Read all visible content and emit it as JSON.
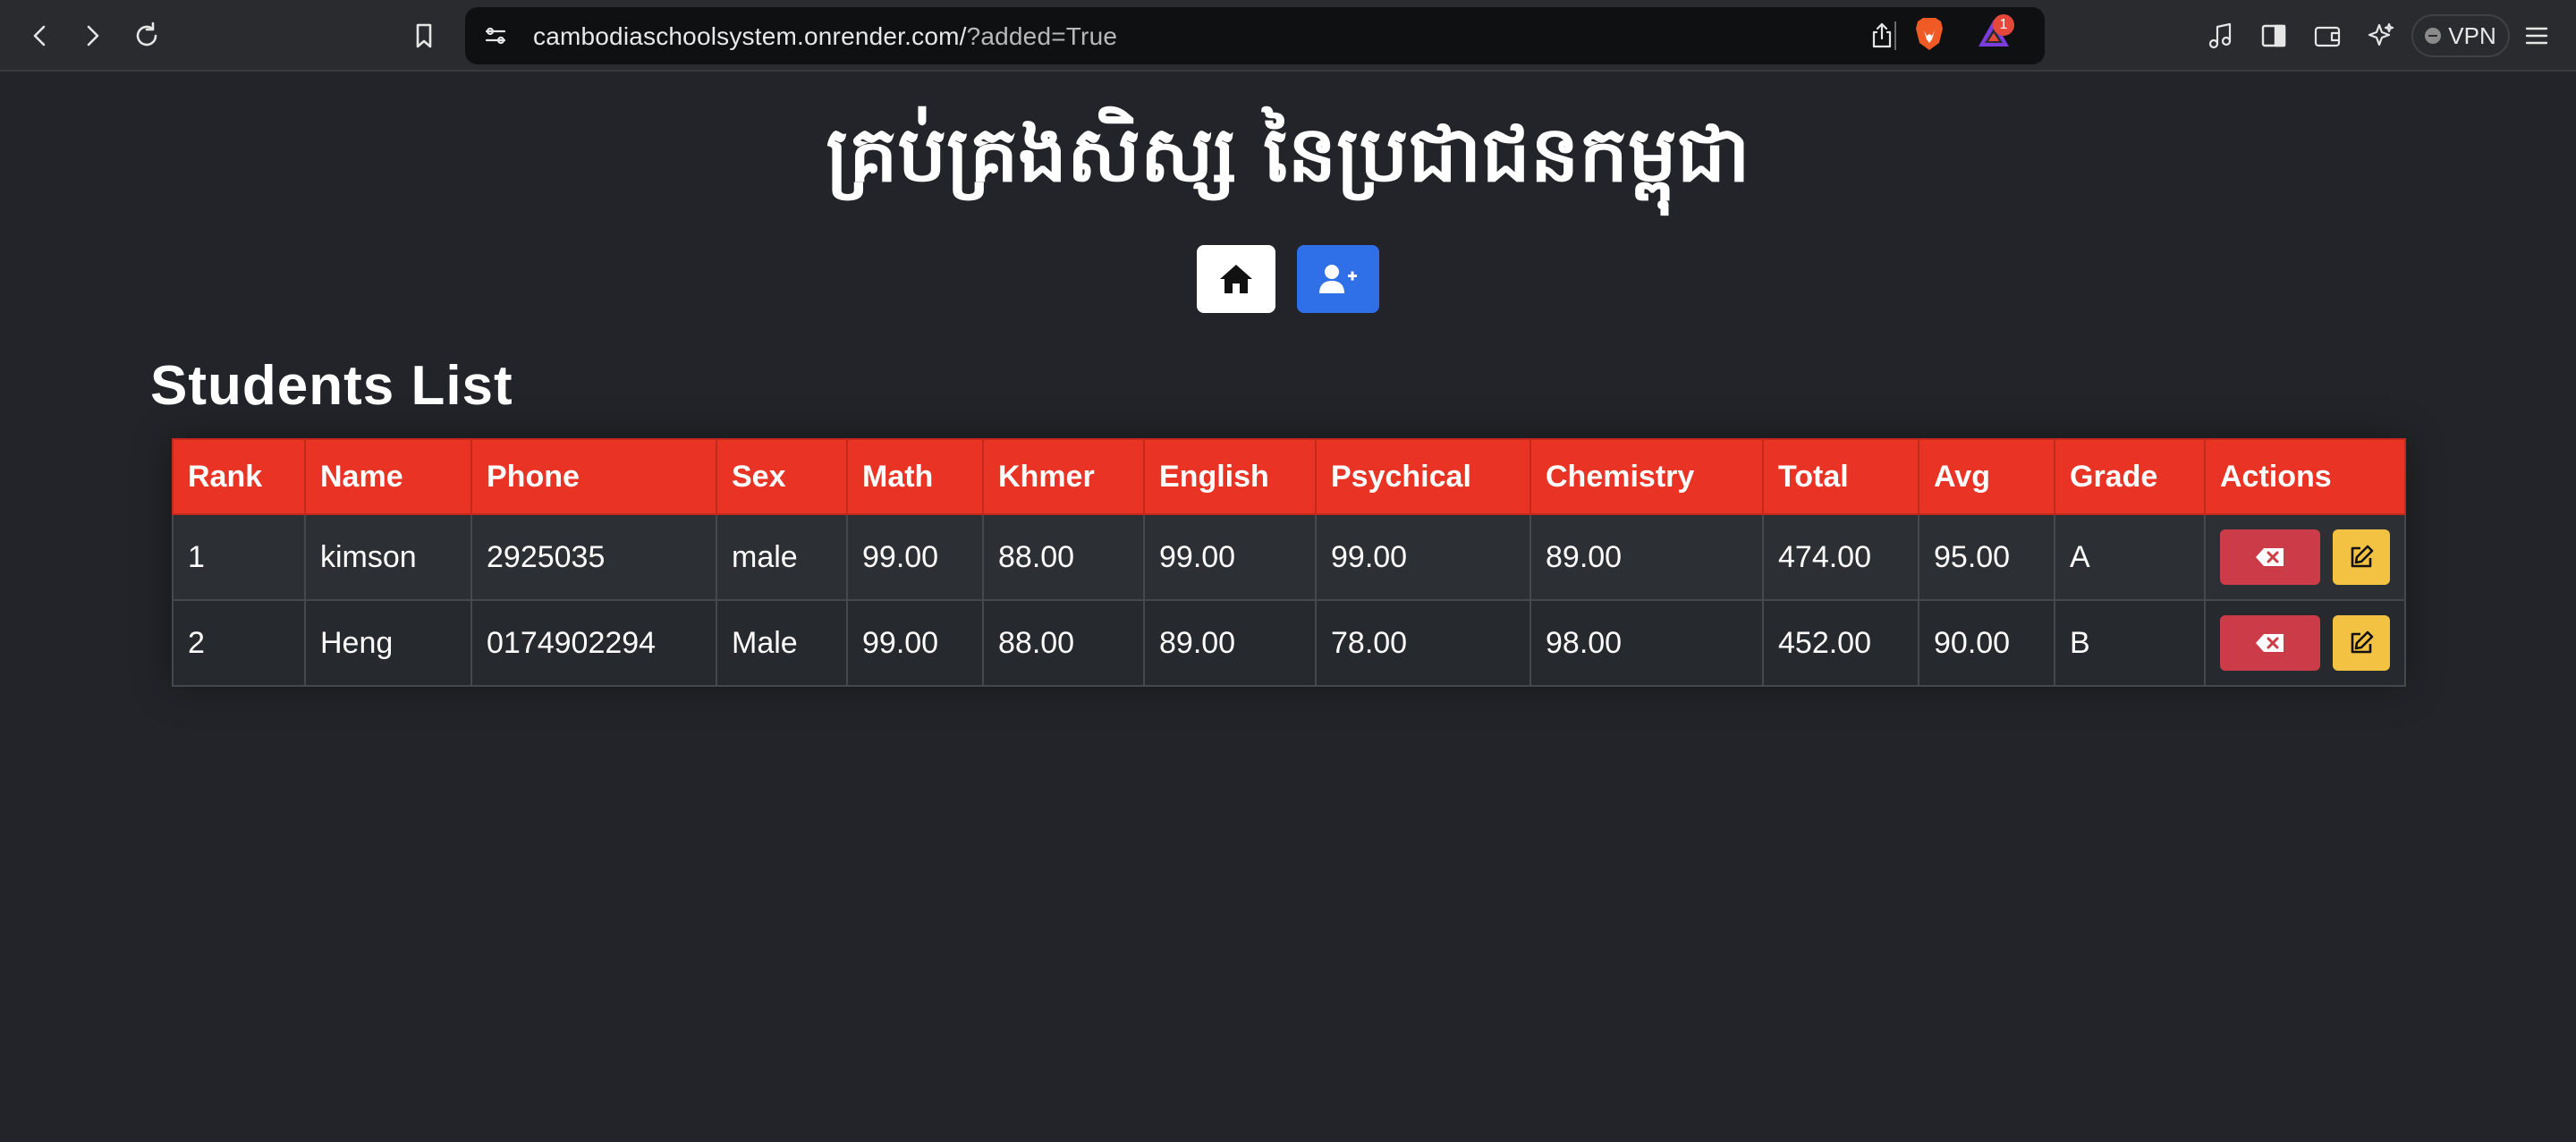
{
  "browser": {
    "url_main": "cambodiaschoolsystem.onrender.com/",
    "url_query": "?added=True",
    "notification_count": "1",
    "vpn_label": "VPN"
  },
  "page": {
    "title": "គ្រប់គ្រងសិស្ស នៃប្រជាជនកម្ពុជា",
    "section_title": "Students List"
  },
  "nav": {
    "home_icon": "home-icon",
    "add_icon": "add-user-icon",
    "add_button_color": "#2f6fe8"
  },
  "table": {
    "headers": [
      "Rank",
      "Name",
      "Phone",
      "Sex",
      "Math",
      "Khmer",
      "English",
      "Psychical",
      "Chemistry",
      "Total",
      "Avg",
      "Grade",
      "Actions"
    ],
    "rows": [
      {
        "rank": "1",
        "name": "kimson",
        "phone": "2925035",
        "sex": "male",
        "math": "99.00",
        "khmer": "88.00",
        "english": "99.00",
        "psychical": "99.00",
        "chemistry": "89.00",
        "total": "474.00",
        "avg": "95.00",
        "grade": "A"
      },
      {
        "rank": "2",
        "name": "Heng",
        "phone": "0174902294",
        "sex": "Male",
        "math": "99.00",
        "khmer": "88.00",
        "english": "89.00",
        "psychical": "78.00",
        "chemistry": "98.00",
        "total": "452.00",
        "avg": "90.00",
        "grade": "B"
      }
    ]
  },
  "colors": {
    "header_red": "#e83325",
    "delete_red": "#cc3b48",
    "edit_yellow": "#f4c243",
    "background": "#222429"
  }
}
